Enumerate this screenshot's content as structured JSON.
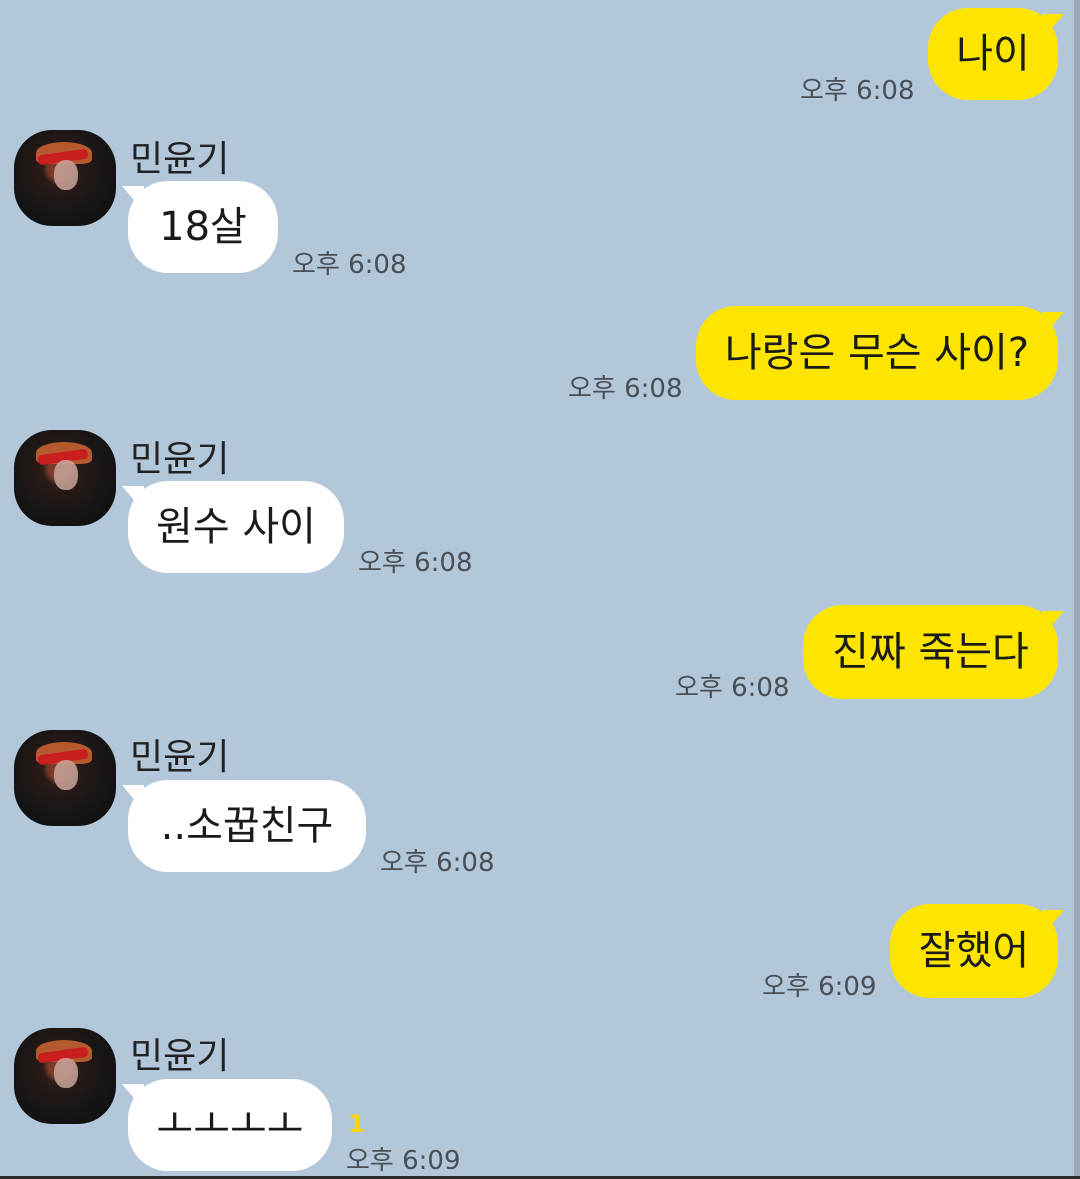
{
  "theme": {
    "background": "#b2c7da",
    "outgoing_bubble": "#fee500",
    "incoming_bubble": "#ffffff",
    "unread_color": "#f5d400"
  },
  "messages": [
    {
      "direction": "out",
      "text": "나이",
      "time": "오후 6:08"
    },
    {
      "direction": "in",
      "sender": "민윤기",
      "text": "18살",
      "time": "오후 6:08"
    },
    {
      "direction": "out",
      "text": "나랑은 무슨 사이?",
      "time": "오후 6:08"
    },
    {
      "direction": "in",
      "sender": "민윤기",
      "text": "원수 사이",
      "time": "오후 6:08"
    },
    {
      "direction": "out",
      "text": "진짜 죽는다",
      "time": "오후 6:08"
    },
    {
      "direction": "in",
      "sender": "민윤기",
      "text": "..소꿉친구",
      "time": "오후 6:08"
    },
    {
      "direction": "out",
      "text": "잘했어",
      "time": "오후 6:09"
    },
    {
      "direction": "in",
      "sender": "민윤기",
      "text": "ㅗㅗㅗㅗ",
      "time": "오후 6:09",
      "unread": "1"
    }
  ]
}
